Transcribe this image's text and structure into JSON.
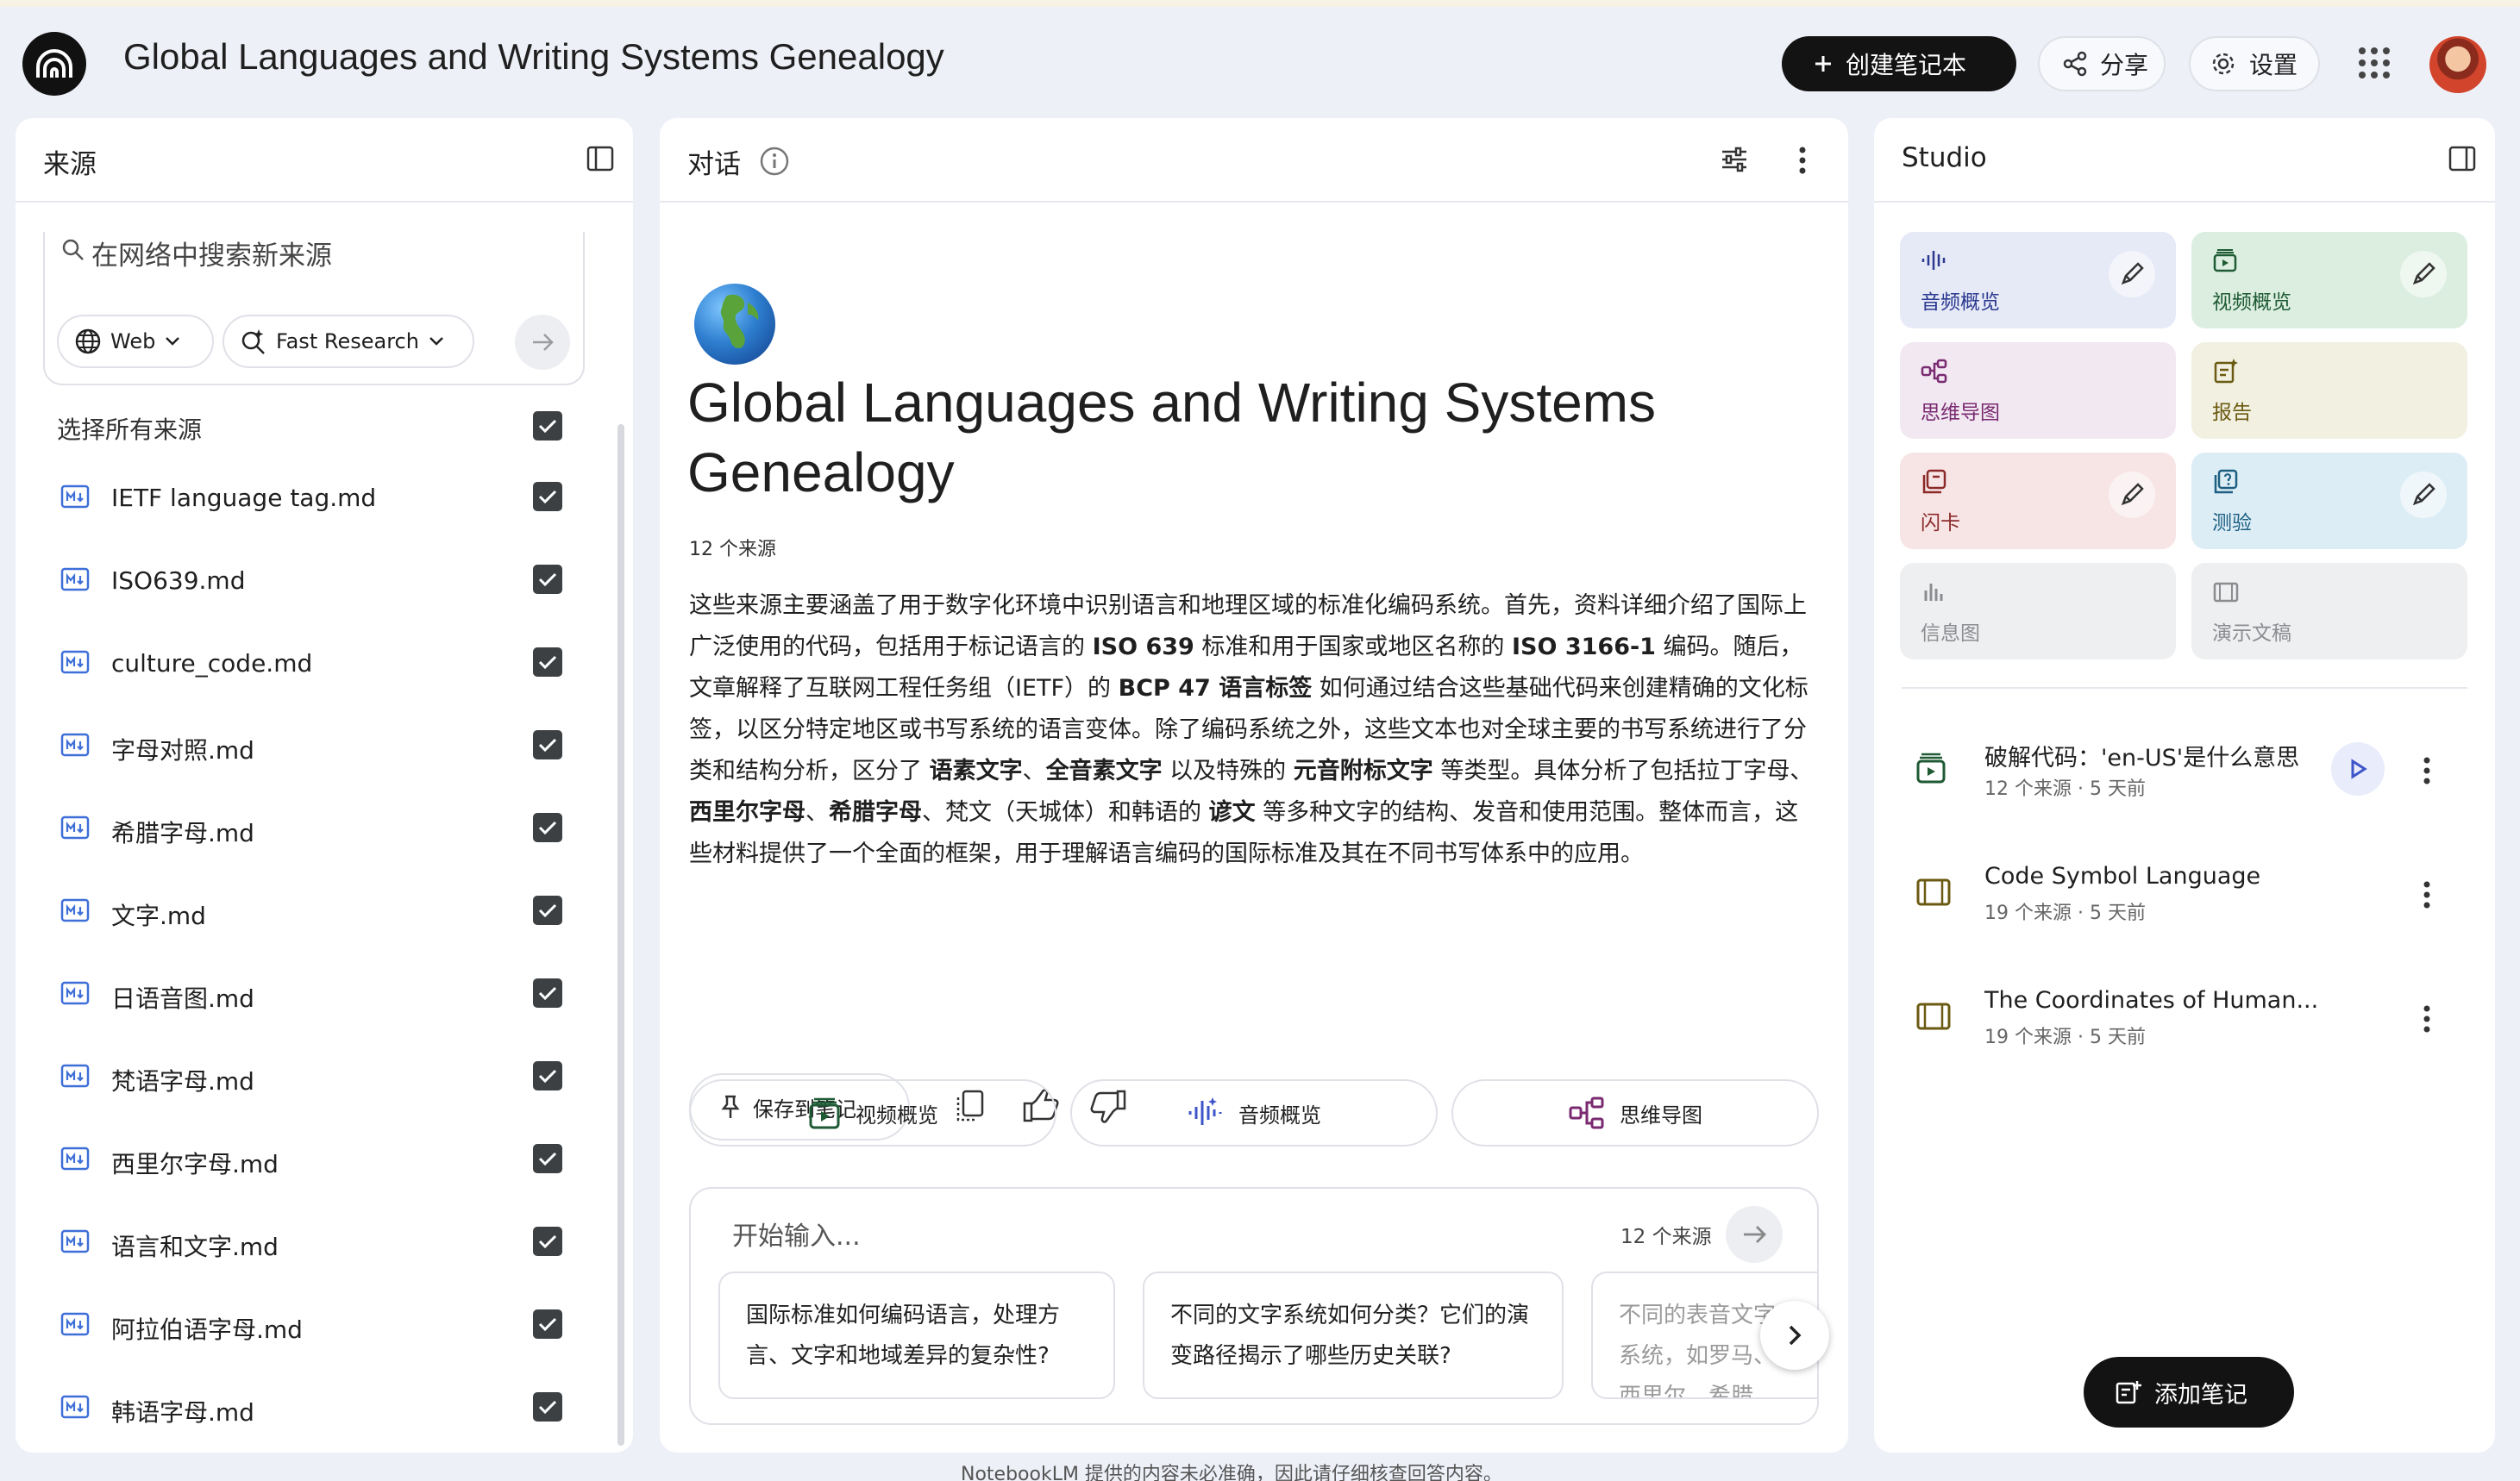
{
  "app": {
    "title": "Global Languages and Writing Systems Genealogy",
    "create_label": "创建笔记本",
    "share_label": "分享",
    "settings_label": "设置"
  },
  "sources": {
    "header": "来源",
    "search_placeholder": "在网络中搜索新来源",
    "web_chip": "Web",
    "fast_chip": "Fast Research",
    "select_all": "选择所有来源",
    "items": [
      "IETF language tag.md",
      "ISO639.md",
      "culture_code.md",
      "字母对照.md",
      "希腊字母.md",
      "文字.md",
      "日语音图.md",
      "梵语字母.md",
      "西里尔字母.md",
      "语言和文字.md",
      "阿拉伯语字母.md",
      "韩语字母.md"
    ]
  },
  "chat": {
    "header": "对话",
    "notebook_title": "Global Languages and Writing Systems Genealogy",
    "source_count": "12 个来源",
    "summary": [
      {
        "t": "这些来源主要涵盖了用于数字化环境中识别语言和地理区域的标准化编码系统。首先，资料详细介绍了国际上广泛使用的代码，包括用于标记语言的 ",
        "b": false
      },
      {
        "t": "ISO 639",
        "b": true
      },
      {
        "t": " 标准和用于国家或地区名称的 ",
        "b": false
      },
      {
        "t": "ISO 3166-1",
        "b": true
      },
      {
        "t": " 编码。随后，文章解释了互联网工程任务组（IETF）的 ",
        "b": false
      },
      {
        "t": "BCP 47 语言标签",
        "b": true
      },
      {
        "t": " 如何通过结合这些基础代码来创建精确的文化标签，以区分特定地区或书写系统的语言变体。除了编码系统之外，这些文本也对全球主要的书写系统进行了分类和结构分析，区分了 ",
        "b": false
      },
      {
        "t": "语素文字",
        "b": true
      },
      {
        "t": "、",
        "b": false
      },
      {
        "t": "全音素文字",
        "b": true
      },
      {
        "t": " 以及特殊的 ",
        "b": false
      },
      {
        "t": "元音附标文字",
        "b": true
      },
      {
        "t": " 等类型。具体分析了包括拉丁字母、",
        "b": false
      },
      {
        "t": "西里尔字母",
        "b": true
      },
      {
        "t": "、",
        "b": false
      },
      {
        "t": "希腊字母",
        "b": true
      },
      {
        "t": "、梵文（天城体）和韩语的 ",
        "b": false
      },
      {
        "t": "谚文",
        "b": true
      },
      {
        "t": " 等多种文字的结构、发音和使用范围。整体而言，这些材料提供了一个全面的框架，用于理解语言编码的国际标准及其在不同书写体系中的应用。",
        "b": false
      }
    ],
    "save_label": "保存到笔记",
    "quick_actions": [
      "视频概览",
      "音频概览",
      "思维导图"
    ],
    "input_placeholder": "开始输入...",
    "input_source_count": "12 个来源",
    "suggestions": [
      "国际标准如何编码语言，处理方言、文字和地域差异的复杂性?",
      "不同的文字系统如何分类？它们的演变路径揭示了哪些历史关联?",
      "不同的表音文字系统，如罗马、西里尔、希腊、梵文）"
    ]
  },
  "studio": {
    "header": "Studio",
    "tiles": [
      {
        "label": "音频概览",
        "icon": "audio-wave-icon",
        "bg": "#e6e9f6",
        "fg": "#2b3990",
        "edit": true
      },
      {
        "label": "视频概览",
        "icon": "video-icon",
        "bg": "#dbeee0",
        "fg": "#1e5a33",
        "edit": true
      },
      {
        "label": "思维导图",
        "icon": "mindmap-icon",
        "bg": "#f1e8f2",
        "fg": "#7a2a70",
        "edit": false
      },
      {
        "label": "报告",
        "icon": "report-icon",
        "bg": "#f1f0e1",
        "fg": "#6b5a12",
        "edit": false
      },
      {
        "label": "闪卡",
        "icon": "flashcard-icon",
        "bg": "#f7e5e5",
        "fg": "#8c2a2a",
        "edit": true
      },
      {
        "label": "测验",
        "icon": "quiz-icon",
        "bg": "#dcedf5",
        "fg": "#1d5f82",
        "edit": true
      },
      {
        "label": "信息图",
        "icon": "infographic-icon",
        "bg": "#eeeff1",
        "fg": "#8a8c90",
        "edit": false
      },
      {
        "label": "演示文稿",
        "icon": "slides-icon",
        "bg": "#eeeff1",
        "fg": "#8a8c90",
        "edit": false
      }
    ],
    "notes": [
      {
        "title": "破解代码：'en-US'是什么意思",
        "meta": "12 个来源 · 5 天前",
        "icon": "video-note-icon",
        "play": true
      },
      {
        "title": "Code Symbol Language",
        "meta": "19 个来源 · 5 天前",
        "icon": "slides-note-icon",
        "play": false
      },
      {
        "title": "The Coordinates of Human...",
        "meta": "19 个来源 · 5 天前",
        "icon": "slides-note-icon",
        "play": false
      }
    ],
    "add_note_label": "添加笔记"
  },
  "footer": {
    "disclaimer": "NotebookLM 提供的内容未必准确，因此请仔细核查回答内容。"
  }
}
